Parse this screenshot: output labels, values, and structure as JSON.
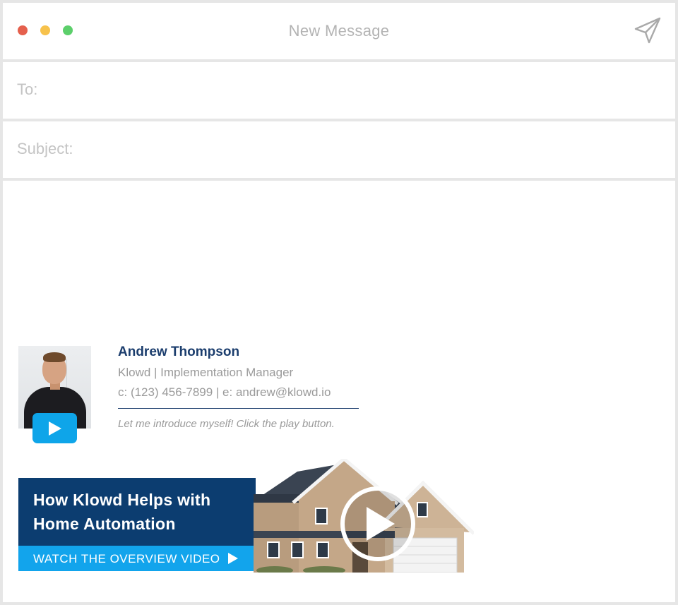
{
  "window": {
    "title": "New Message",
    "send_icon": "paper-plane-icon",
    "controls": [
      "close",
      "minimize",
      "maximize"
    ],
    "control_colors": {
      "close": "#e5604d",
      "minimize": "#f7c24c",
      "maximize": "#5ccf6b"
    }
  },
  "fields": {
    "to_label": "To:",
    "subject_label": "Subject:"
  },
  "signature": {
    "name": "Andrew Thompson",
    "role": "Klowd | Implementation Manager",
    "contact": "c: (123) 456-7899 | e: andrew@klowd.io",
    "note": "Let me introduce myself! Click the play button.",
    "name_color": "#1b3d6d",
    "play_icon": "play-icon"
  },
  "banner": {
    "title": "How Klowd Helps with Home Automation",
    "cta": "WATCH THE OVERVIEW VIDEO",
    "bg_color": "#0c3d70",
    "cta_color": "#12a4ec",
    "image": "house-thumbnail",
    "overlay_icon": "play-circle-icon"
  }
}
